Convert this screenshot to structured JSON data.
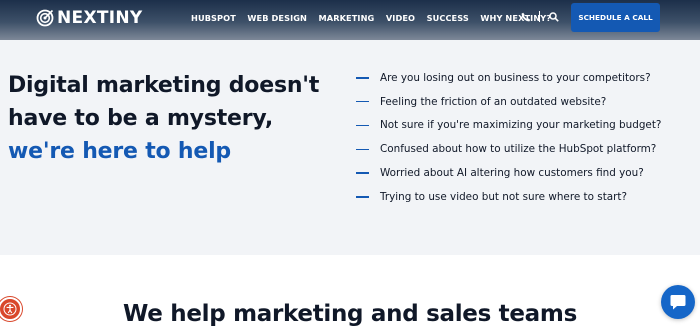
{
  "header": {
    "logo_text": "NEXTINY",
    "nav": [
      "HUBSPOT",
      "WEB DESIGN",
      "MARKETING",
      "VIDEO",
      "SUCCESS",
      "WHY NEXTINY?"
    ],
    "cta_label": "SCHEDULE A CALL",
    "icons": [
      "target-logo-icon",
      "phone-icon",
      "search-icon"
    ]
  },
  "hero": {
    "headline_line1": "Digital marketing doesn't",
    "headline_line2": "have to be a mystery,",
    "headline_highlight": "we're here to help",
    "questions": [
      "Are you losing out on business to your competitors?",
      "Feeling the friction of an outdated website?",
      "Not sure if you're maximizing your marketing budget?",
      "Confused about how to utilize the HubSpot platform?",
      "Worried about AI altering how customers find you?",
      "Trying to use video but not sure where to start?"
    ]
  },
  "section": {
    "heading": "We help marketing and sales teams"
  },
  "floating": {
    "icons": [
      "accessibility-icon",
      "chat-icon"
    ]
  },
  "colors": {
    "accent": "#1459b3",
    "hero_bg": "#f2f4f7",
    "text": "#101828",
    "accessibility": "#d9472b",
    "chat": "#1566c8"
  }
}
